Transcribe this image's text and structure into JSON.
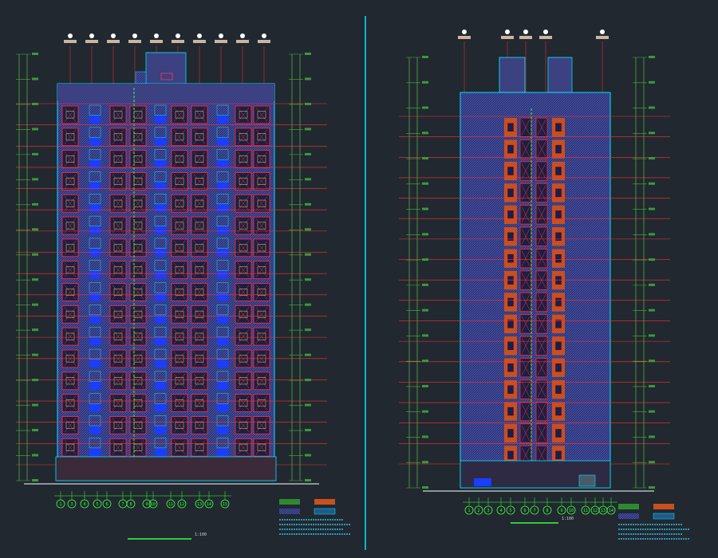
{
  "drawing": {
    "background": "#212830",
    "colors": {
      "floor_line": "#ff3030",
      "window_red": "#ff2a2a",
      "window_blue": "#1a3dff",
      "facade_hatch": "#5b63d6",
      "orange_panel": "#c8501e",
      "dimension_green": "#4fae3a",
      "cyan_accent": "#00e5ff",
      "axis_green": "#3dff3d"
    }
  },
  "left_elevation": {
    "title": "",
    "scale": "1:100",
    "floors": 17,
    "bay_count": 11,
    "axis_labels": [
      "1",
      "3",
      "4",
      "5",
      "6",
      "7",
      "8",
      "9",
      "10",
      "11",
      "12",
      "13",
      "14",
      "15"
    ],
    "legend": {
      "swatches": [
        "green-hatch",
        "orange-panel",
        "blue-hatch",
        "cyan-hatch"
      ]
    }
  },
  "right_elevation": {
    "title": "",
    "scale": "1:100",
    "floors": 17,
    "axis_labels": [
      "1",
      "2",
      "3",
      "4",
      "5",
      "6",
      "7",
      "8",
      "9",
      "10",
      "11",
      "12",
      "13",
      "14"
    ],
    "legend": {
      "swatches": [
        "green-hatch",
        "orange-panel",
        "blue-hatch",
        "cyan-hatch"
      ]
    }
  }
}
